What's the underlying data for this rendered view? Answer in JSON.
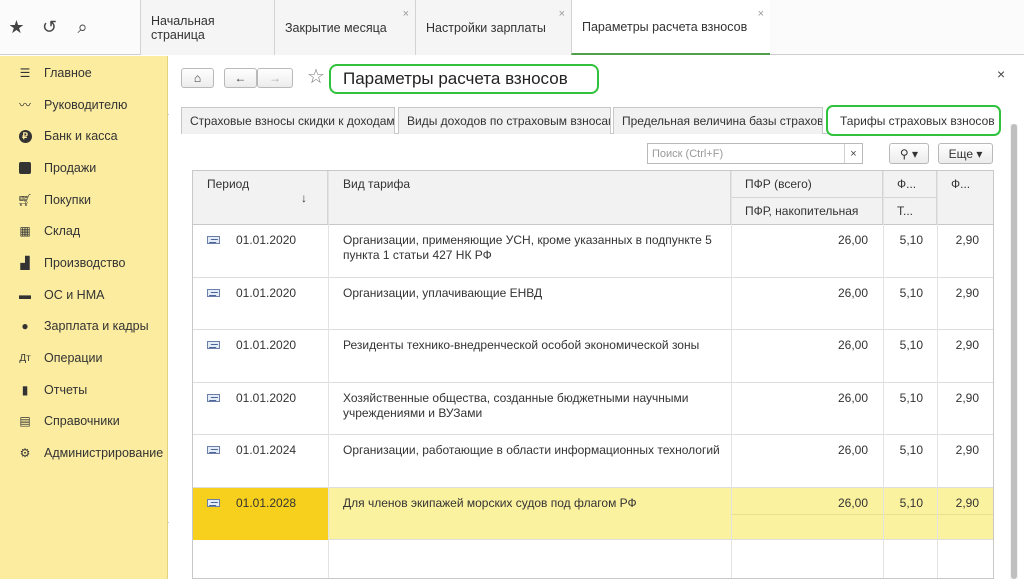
{
  "top_icons": [
    {
      "name": "apps-grid-icon",
      "glyph": "☷"
    },
    {
      "name": "favorites-star-icon",
      "glyph": "★"
    },
    {
      "name": "history-icon",
      "glyph": "↺"
    },
    {
      "name": "search-icon",
      "glyph": "⌕"
    }
  ],
  "tabs": [
    {
      "label": "Начальная страница",
      "closable": false
    },
    {
      "label": "Закрытие месяца",
      "closable": true
    },
    {
      "label": "Настройки зарплаты",
      "closable": true
    },
    {
      "label": "Параметры расчета взносов",
      "closable": true
    }
  ],
  "sidebar": {
    "items": [
      {
        "label": "Главное",
        "icon": "menu-icon"
      },
      {
        "label": "Руководителю",
        "icon": "trend-icon"
      },
      {
        "label": "Банк и касса",
        "icon": "coin-icon"
      },
      {
        "label": "Продажи",
        "icon": "bag-icon"
      },
      {
        "label": "Покупки",
        "icon": "cart-icon"
      },
      {
        "label": "Склад",
        "icon": "warehouse-icon"
      },
      {
        "label": "Производство",
        "icon": "factory-icon"
      },
      {
        "label": "ОС и НМА",
        "icon": "truck-icon"
      },
      {
        "label": "Зарплата и кадры",
        "icon": "person-icon"
      },
      {
        "label": "Операции",
        "icon": "operations-icon"
      },
      {
        "label": "Отчеты",
        "icon": "bar-chart-icon"
      },
      {
        "label": "Справочники",
        "icon": "book-icon"
      },
      {
        "label": "Администрирование",
        "icon": "gear-icon"
      }
    ]
  },
  "header": {
    "title": "Параметры расчета взносов",
    "close_glyph": "×",
    "home_glyph": "⌂",
    "back_glyph": "←",
    "forward_glyph": "→",
    "star_glyph": "☆"
  },
  "form_tabs": [
    {
      "label": "Страховые взносы скидки к доходам"
    },
    {
      "label": "Виды доходов по страховым взносам"
    },
    {
      "label": "Предельная величина базы страховых взносов"
    },
    {
      "label": "Тарифы страховых взносов"
    }
  ],
  "toolbar": {
    "search_placeholder": "Поиск (Ctrl+F)",
    "clear_glyph": "×",
    "search_btn_glyph": "⚲ ▾",
    "more_label": "Еще ▾"
  },
  "table": {
    "headers": {
      "period": "Период",
      "sort_arrow": "↓",
      "tariff": "Вид тарифа",
      "pfr_total": "ПФР (всего)",
      "pfr_funded": "ПФР, накопительная",
      "col_f1_top": "Ф...",
      "col_f1_bottom": "Т...",
      "col_f2": "Ф..."
    },
    "rows": [
      {
        "period": "01.01.2020",
        "tariff": "Организации, применяющие УСН, кроме указанных в подпункте 5 пункта 1 статьи 427 НК РФ",
        "pfr": "26,00",
        "f1": "5,10",
        "f2": "2,90",
        "selected": false
      },
      {
        "period": "01.01.2020",
        "tariff": "Организации, уплачивающие ЕНВД",
        "pfr": "26,00",
        "f1": "5,10",
        "f2": "2,90",
        "selected": false
      },
      {
        "period": "01.01.2020",
        "tariff": "Резиденты технико-внедренческой особой экономической зоны",
        "pfr": "26,00",
        "f1": "5,10",
        "f2": "2,90",
        "selected": false
      },
      {
        "period": "01.01.2020",
        "tariff": "Хозяйственные общества, созданные бюджетными научными учреждениями и ВУЗами",
        "pfr": "26,00",
        "f1": "5,10",
        "f2": "2,90",
        "selected": false
      },
      {
        "period": "01.01.2024",
        "tariff": "Организации, работающие в области информационных технологий",
        "pfr": "26,00",
        "f1": "5,10",
        "f2": "2,90",
        "selected": false
      },
      {
        "period": "01.01.2028",
        "tariff": "Для членов экипажей морских судов под флагом РФ",
        "pfr": "26,00",
        "f1": "5,10",
        "f2": "2,90",
        "selected": true
      }
    ]
  },
  "colors": {
    "sidebar_bg": "#fbeca0",
    "highlight_outline": "#31c23d",
    "selected_row": "#fbf2a0",
    "selected_cell": "#f7d01d"
  }
}
